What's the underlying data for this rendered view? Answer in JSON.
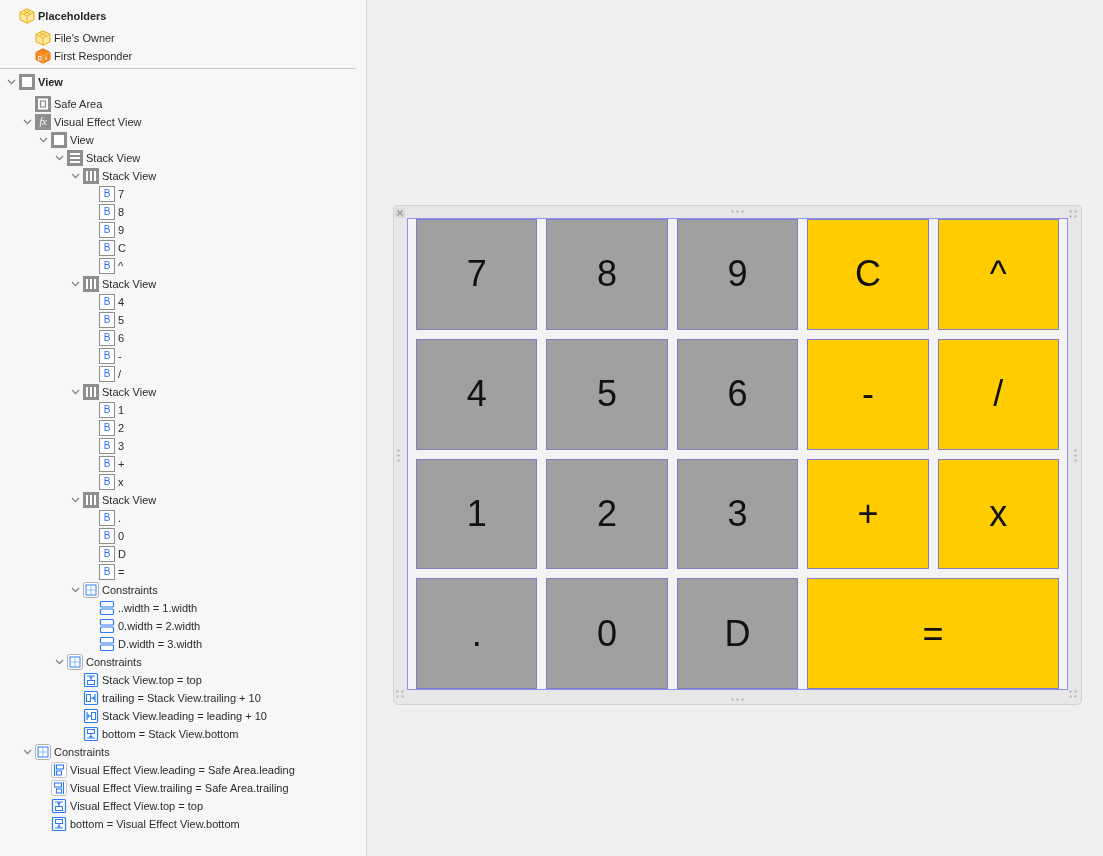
{
  "placeholders": {
    "title": "Placeholders",
    "items": [
      {
        "label": "File's Owner",
        "kind": "placeholder"
      },
      {
        "label": "First Responder",
        "kind": "responder"
      }
    ]
  },
  "outline": [
    {
      "label": "View",
      "kind": "view",
      "expanded": true,
      "children": [
        {
          "label": "Safe Area",
          "kind": "safe-area"
        },
        {
          "label": "Visual Effect View",
          "kind": "effect",
          "glyph": "fx",
          "expanded": true,
          "children": [
            {
              "label": "View",
              "kind": "view",
              "expanded": true,
              "children": [
                {
                  "label": "Stack View",
                  "kind": "vstack",
                  "expanded": true,
                  "children": [
                    {
                      "label": "Stack View",
                      "kind": "hstack",
                      "expanded": true,
                      "children": [
                        {
                          "label": "7",
                          "kind": "button",
                          "glyph": "B"
                        },
                        {
                          "label": "8",
                          "kind": "button",
                          "glyph": "B"
                        },
                        {
                          "label": "9",
                          "kind": "button",
                          "glyph": "B"
                        },
                        {
                          "label": "C",
                          "kind": "button",
                          "glyph": "B"
                        },
                        {
                          "label": "^",
                          "kind": "button",
                          "glyph": "B"
                        }
                      ]
                    },
                    {
                      "label": "Stack View",
                      "kind": "hstack",
                      "expanded": true,
                      "children": [
                        {
                          "label": "4",
                          "kind": "button",
                          "glyph": "B"
                        },
                        {
                          "label": "5",
                          "kind": "button",
                          "glyph": "B"
                        },
                        {
                          "label": "6",
                          "kind": "button",
                          "glyph": "B"
                        },
                        {
                          "label": "-",
                          "kind": "button",
                          "glyph": "B"
                        },
                        {
                          "label": "/",
                          "kind": "button",
                          "glyph": "B"
                        }
                      ]
                    },
                    {
                      "label": "Stack View",
                      "kind": "hstack",
                      "expanded": true,
                      "children": [
                        {
                          "label": "1",
                          "kind": "button",
                          "glyph": "B"
                        },
                        {
                          "label": "2",
                          "kind": "button",
                          "glyph": "B"
                        },
                        {
                          "label": "3",
                          "kind": "button",
                          "glyph": "B"
                        },
                        {
                          "label": "+",
                          "kind": "button",
                          "glyph": "B"
                        },
                        {
                          "label": "x",
                          "kind": "button",
                          "glyph": "B"
                        }
                      ]
                    },
                    {
                      "label": "Stack View",
                      "kind": "hstack",
                      "expanded": true,
                      "children": [
                        {
                          "label": ".",
                          "kind": "button",
                          "glyph": "B"
                        },
                        {
                          "label": "0",
                          "kind": "button",
                          "glyph": "B"
                        },
                        {
                          "label": "D",
                          "kind": "button",
                          "glyph": "B"
                        },
                        {
                          "label": "=",
                          "kind": "button",
                          "glyph": "B"
                        }
                      ]
                    },
                    {
                      "label": "Constraints",
                      "kind": "constraints",
                      "expanded": true,
                      "children": [
                        {
                          "label": "..width = 1.width",
                          "kind": "equal-width"
                        },
                        {
                          "label": "0.width = 2.width",
                          "kind": "equal-width"
                        },
                        {
                          "label": "D.width = 3.width",
                          "kind": "equal-width"
                        }
                      ]
                    }
                  ]
                },
                {
                  "label": "Constraints",
                  "kind": "constraints",
                  "expanded": true,
                  "children": [
                    {
                      "label": "Stack View.top = top",
                      "kind": "top"
                    },
                    {
                      "label": "trailing = Stack View.trailing + 10",
                      "kind": "trailing"
                    },
                    {
                      "label": "Stack View.leading = leading + 10",
                      "kind": "leading"
                    },
                    {
                      "label": "bottom = Stack View.bottom",
                      "kind": "bottom"
                    }
                  ]
                }
              ]
            }
          ]
        },
        {
          "label": "Constraints",
          "kind": "constraints",
          "expanded": true,
          "children": [
            {
              "label": "Visual Effect View.leading = Safe Area.leading",
              "kind": "align-leading"
            },
            {
              "label": "Visual Effect View.trailing = Safe Area.trailing",
              "kind": "align-trailing"
            },
            {
              "label": "Visual Effect View.top = top",
              "kind": "top"
            },
            {
              "label": "bottom = Visual Effect View.bottom",
              "kind": "bottom"
            }
          ]
        }
      ]
    }
  ],
  "canvas": {
    "rows": [
      {
        "keys": [
          {
            "label": "7",
            "color": "#a0a0a0"
          },
          {
            "label": "8",
            "color": "#a0a0a0"
          },
          {
            "label": "9",
            "color": "#a0a0a0"
          },
          {
            "label": "C",
            "color": "#ffcc00"
          },
          {
            "label": "^",
            "color": "#ffcc00"
          }
        ]
      },
      {
        "keys": [
          {
            "label": "4",
            "color": "#a0a0a0"
          },
          {
            "label": "5",
            "color": "#a0a0a0"
          },
          {
            "label": "6",
            "color": "#a0a0a0"
          },
          {
            "label": "-",
            "color": "#ffcc00"
          },
          {
            "label": "/",
            "color": "#ffcc00"
          }
        ]
      },
      {
        "keys": [
          {
            "label": "1",
            "color": "#a0a0a0"
          },
          {
            "label": "2",
            "color": "#a0a0a0"
          },
          {
            "label": "3",
            "color": "#a0a0a0"
          },
          {
            "label": "+",
            "color": "#ffcc00"
          },
          {
            "label": "x",
            "color": "#ffcc00"
          }
        ]
      },
      {
        "keys": [
          {
            "label": ".",
            "color": "#a0a0a0"
          },
          {
            "label": "0",
            "color": "#a0a0a0"
          },
          {
            "label": "D",
            "color": "#a0a0a0"
          },
          {
            "label": "=",
            "color": "#ffcc00"
          }
        ]
      }
    ]
  }
}
